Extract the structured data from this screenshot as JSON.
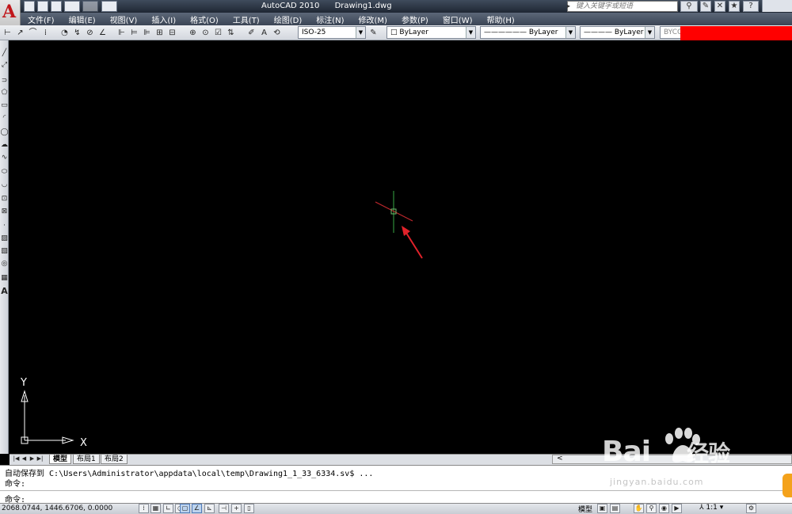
{
  "titlebar": {
    "app_name": "AutoCAD 2010",
    "file_name": "Drawing1.dwg",
    "search_placeholder": "键入关键字或短语",
    "logo_letter": "A"
  },
  "menu": [
    "文件(F)",
    "编辑(E)",
    "视图(V)",
    "插入(I)",
    "格式(O)",
    "工具(T)",
    "绘图(D)",
    "标注(N)",
    "修改(M)",
    "参数(P)",
    "窗口(W)",
    "帮助(H)"
  ],
  "toolbar": {
    "dim_style": "ISO-25",
    "color": "ByLayer",
    "linetype": "ByLayer",
    "lineweight": "ByLayer",
    "plot_style": "BYCO"
  },
  "layout_tabs": [
    "模型",
    "布局1",
    "布局2"
  ],
  "command": {
    "autosave_label": "自动保存到",
    "autosave_path": "C:\\Users\\Administrator\\appdata\\local\\temp\\Drawing1_1_33_6334.sv$ ...",
    "prompt1": "命令:",
    "prompt2": "命令:"
  },
  "statusbar": {
    "coordinates": "2068.0744, 1446.6706, 0.0000",
    "model_label": "模型",
    "annotation_scale": "1:1"
  },
  "ucs": {
    "y_label": "Y",
    "x_label": "X"
  },
  "watermark": {
    "brand": "Bai",
    "brand_cn": "经验",
    "url": "jingyan.baidu.com"
  },
  "colors": {
    "canvas_bg": "#000000",
    "axis_x": "#c0282d",
    "axis_y": "#2e8b3a",
    "arrow": "#e1222a",
    "redacted": "#ff0000"
  }
}
